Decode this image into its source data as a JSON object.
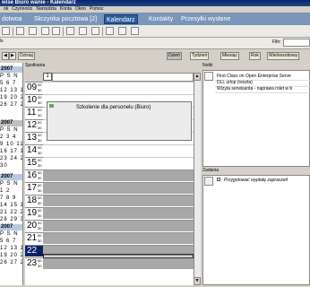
{
  "window": {
    "title": "wise Biuro wanie - Kalendarz"
  },
  "menu": [
    "ok",
    "Czynności",
    "Narzędzia",
    "Konta",
    "Okno",
    "Pomoc"
  ],
  "tabs": [
    {
      "label": "dotwoa"
    },
    {
      "label": "Skrzynka pocztowa [2]"
    },
    {
      "label": "Kalendarz"
    },
    {
      "label": "Kontakty"
    },
    {
      "label": "Przesyłki wysłane"
    }
  ],
  "toolbar": {
    "filter_label": "Filtr:",
    "filter_value": "",
    "combo_value": "ls"
  },
  "viewbar": {
    "today": "Dzisiaj",
    "day": "Dzień",
    "week": "Tydzień",
    "month": "Miesiąc",
    "year": "Rok",
    "multi": "Wieloosobowy"
  },
  "sidebar": {
    "months": [
      {
        "header": "2007",
        "rows": [
          "P S N",
          "5 6 7",
          "12 13 14",
          "19 20 21",
          "26 27 28"
        ]
      },
      {
        "header": "2007",
        "rows": [
          "P S N",
          "2 3 4",
          "9 10 11",
          "16 17 18",
          "23 24 25",
          "30"
        ]
      },
      {
        "header": "2007",
        "rows": [
          "P S N",
          "1 2",
          "7 8 9",
          "14 15 16",
          "21 22 23",
          "28 29 30"
        ]
      },
      {
        "header": "2007",
        "rows": [
          "P S N",
          "5 6 7",
          "12 13 14",
          "19 20 21",
          "26 27 28"
        ]
      }
    ]
  },
  "schedule": {
    "header": "Spotkania",
    "date_button": "1",
    "hours": [
      "09",
      "10",
      "11",
      "12",
      "13",
      "14",
      "15",
      "16",
      "17",
      "18",
      "19",
      "20",
      "21",
      "22",
      "23"
    ],
    "minutes": [
      "00",
      "30"
    ],
    "event": {
      "title": "Szkolenie dla personelu (Biuro)"
    }
  },
  "notes": {
    "header": "Notki",
    "items": [
      "First Class on Open Enterprise Serve",
      "DLL urlop (reszta)",
      "Wizyta serwisanta - naprawa rolet w b"
    ]
  },
  "tasks": {
    "header": "Zadania",
    "items": [
      "Przygotować wypłatę zapraszeń"
    ]
  }
}
